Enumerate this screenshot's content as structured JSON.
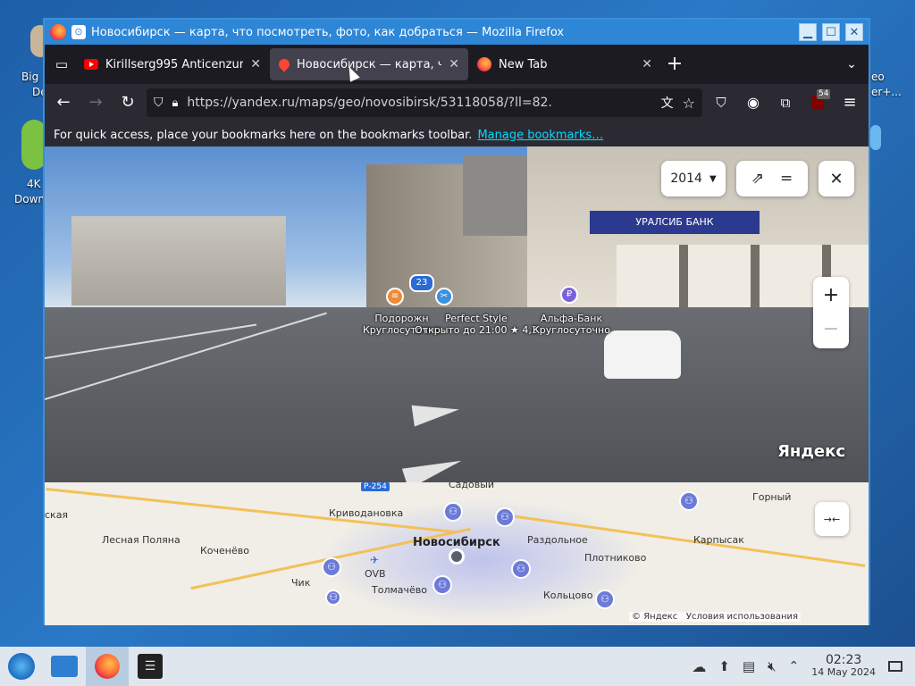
{
  "desktop": {
    "fragments": [
      "Big",
      "De",
      "4K",
      "Down",
      "eo",
      "er+..."
    ]
  },
  "window": {
    "title": "Новосибирск — карта, что посмотреть, фото, как добраться — Mozilla Firefox",
    "controls": [
      "▁",
      "☐",
      "✕"
    ]
  },
  "tabs": [
    {
      "label": "Kirillserg995 Anticenzura",
      "icon": "youtube-icon",
      "active": false
    },
    {
      "label": "Новосибирск — карта, что",
      "icon": "map-pin-icon",
      "active": true
    },
    {
      "label": "New Tab",
      "icon": "firefox-icon",
      "active": false
    }
  ],
  "navbar": {
    "url": "https://yandex.ru/maps/geo/novosibirsk/53118058/?ll=82.",
    "extensions_badge": "54"
  },
  "bookmarks_bar": {
    "message": "For quick access, place your bookmarks here on the bookmarks toolbar.",
    "link": "Manage bookmarks…"
  },
  "streetview": {
    "year": "2014",
    "bank_sign": "УРАЛСИБ БАНК",
    "poi_count": "23",
    "pois": [
      {
        "name": "Подорожн",
        "status": "Круглосуточно"
      },
      {
        "name": "Perfect Style",
        "status": "Открыто до 21:00",
        "rating": "★ 4,3"
      },
      {
        "name": "Альфа-Банк",
        "status": "Круглосуточно"
      }
    ],
    "zoom_in": "+",
    "zoom_out": "−",
    "brand": "Яндекс"
  },
  "map": {
    "road_label": "Р-254",
    "towns": [
      "ская",
      "Криводановка",
      "Садовый",
      "Горный",
      "Лесная Поляна",
      "Кочeнёво",
      "Новосибирск",
      "Раздольное",
      "Карпысак",
      "OVB",
      "Плотниково",
      "Чик",
      "Толмачёво",
      "Кольцово"
    ],
    "collapse_icon": "→←",
    "copyright": "© Яндекс",
    "terms": "Условия использования"
  },
  "taskbar": {
    "time": "02:23",
    "date": "14 May 2024"
  }
}
